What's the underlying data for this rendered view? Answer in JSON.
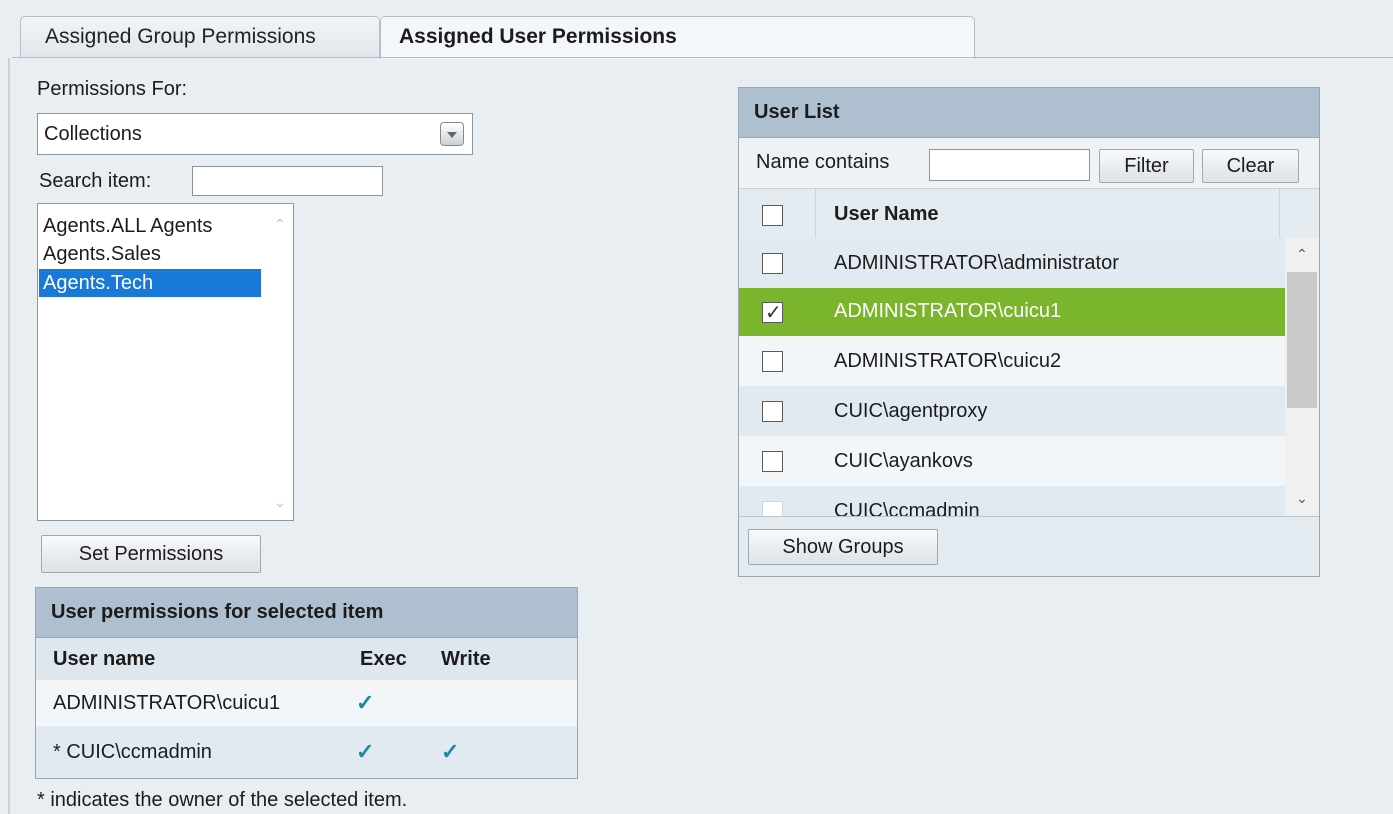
{
  "tabs": [
    {
      "label": "Assigned Group Permissions",
      "active": false
    },
    {
      "label": "Assigned User Permissions",
      "active": true
    }
  ],
  "left": {
    "permissions_for_label": "Permissions For:",
    "permissions_for_value": "Collections",
    "search_label": "Search item:",
    "search_value": "",
    "items": [
      "Agents.ALL Agents",
      "Agents.Sales",
      "Agents.Tech"
    ],
    "selected_item": "Agents.Tech",
    "set_permissions_label": "Set Permissions"
  },
  "user_permissions": {
    "title": "User permissions for selected item",
    "headers": [
      "User name",
      "Exec",
      "Write"
    ],
    "rows": [
      {
        "user": "ADMINISTRATOR\\cuicu1",
        "exec": true,
        "write": false
      },
      {
        "user": "* CUIC\\ccmadmin",
        "exec": true,
        "write": true
      }
    ],
    "check_glyph": "✓",
    "footnote": "* indicates the owner of the selected item."
  },
  "user_list": {
    "title": "User List",
    "name_contains_label": "Name contains",
    "name_contains_value": "",
    "filter_label": "Filter",
    "clear_label": "Clear",
    "column_header": "User Name",
    "users": [
      {
        "name": "ADMINISTRATOR\\administrator",
        "checked": false
      },
      {
        "name": "ADMINISTRATOR\\cuicu1",
        "checked": true
      },
      {
        "name": "ADMINISTRATOR\\cuicu2",
        "checked": false
      },
      {
        "name": "CUIC\\agentproxy",
        "checked": false
      },
      {
        "name": "CUIC\\ayankovs",
        "checked": false
      },
      {
        "name": "CUIC\\ccmadmin",
        "checked": false
      }
    ],
    "show_groups_label": "Show Groups"
  },
  "colors": {
    "selected_row": "#7bb52c",
    "panel_header": "#aec0cf",
    "list_selection": "#1879d8",
    "check_color": "#1f8a9c"
  }
}
